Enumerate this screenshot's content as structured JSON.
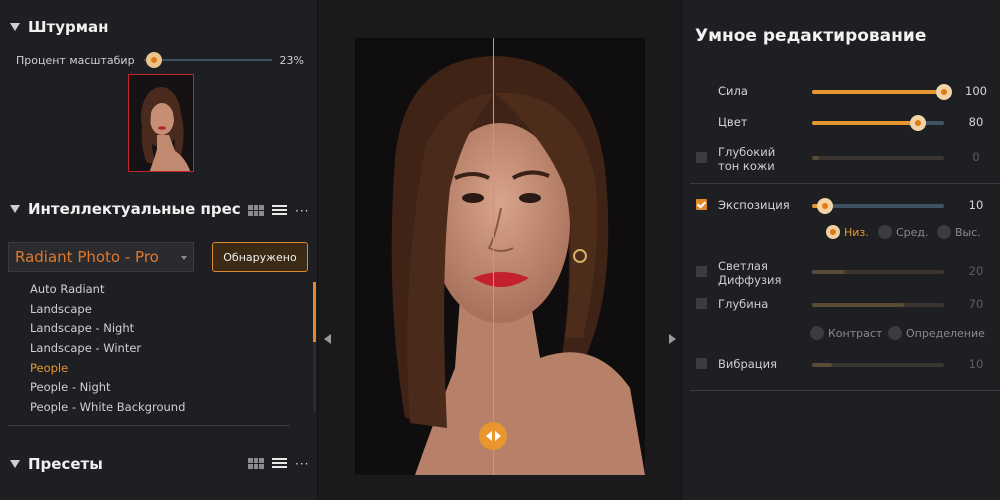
{
  "navigator": {
    "title": "Штурман",
    "zoom_label": "Процент масштабиро",
    "zoom_value": "23%",
    "zoom_fraction": 0.08
  },
  "ai_presets": {
    "title": "Интеллектуальные пресеты",
    "dropdown_value": "Radiant Photo - Pro",
    "detect_button": "Обнаружено",
    "items": [
      {
        "label": "Auto Radiant",
        "active": false
      },
      {
        "label": "Landscape",
        "active": false
      },
      {
        "label": "Landscape - Night",
        "active": false
      },
      {
        "label": "Landscape - Winter",
        "active": false
      },
      {
        "label": "People",
        "active": true
      },
      {
        "label": "People - Night",
        "active": false
      },
      {
        "label": "People - White Background",
        "active": false
      }
    ]
  },
  "presets": {
    "title": "Пресеты"
  },
  "smart_edit": {
    "title": "Умное редактирование",
    "controls": [
      {
        "label": "Сила",
        "value": "100",
        "level": 1.0,
        "checkbox": null,
        "enabled": true
      },
      {
        "label": "Цвет",
        "value": "80",
        "level": 0.8,
        "checkbox": null,
        "enabled": true
      },
      {
        "label": "Глубокий тон кожи",
        "value": "0",
        "level": 0.05,
        "checkbox": "off",
        "enabled": false
      },
      {
        "label": "Экспозиция",
        "value": "10",
        "level": 0.1,
        "checkbox": "on",
        "enabled": true
      },
      {
        "label": "Светлая Диффузия",
        "value": "20",
        "level": 0.25,
        "checkbox": "off",
        "enabled": false
      },
      {
        "label": "Глубина",
        "value": "70",
        "level": 0.7,
        "checkbox": "off",
        "enabled": false
      },
      {
        "label": "Вибрация",
        "value": "10",
        "level": 0.15,
        "checkbox": "off",
        "enabled": false
      }
    ],
    "exposure_modes": [
      {
        "label": "Низ.",
        "selected": true
      },
      {
        "label": "Сред.",
        "selected": false
      },
      {
        "label": "Выс.",
        "selected": false
      }
    ],
    "depth_modes": [
      {
        "label": "Контраст",
        "selected": false
      },
      {
        "label": "Определение",
        "selected": false
      }
    ]
  },
  "colors": {
    "accent": "#e8962e",
    "slider_track": "#3f5264",
    "panel_bg": "#1e1f22"
  }
}
